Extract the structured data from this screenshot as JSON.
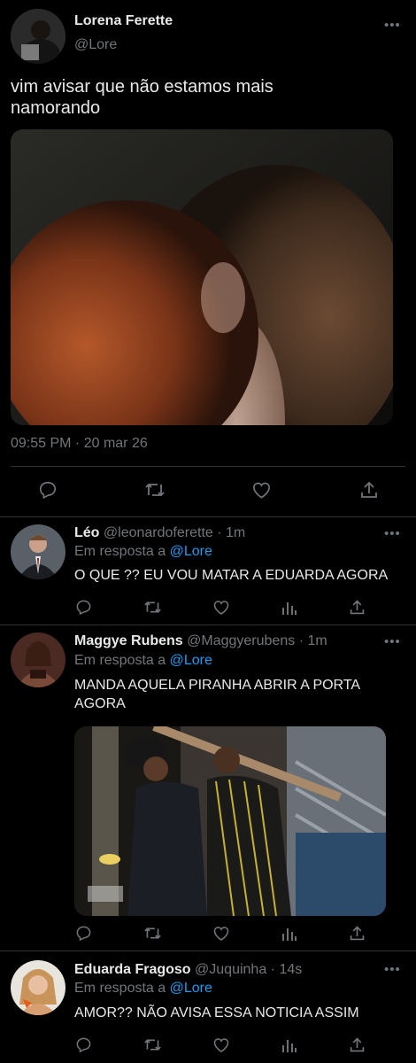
{
  "main_tweet": {
    "name": "Lorena Ferette",
    "handle": "@Lore",
    "more": "•••",
    "text_line1": "vim avisar que não estamos mais",
    "text_line2": "namorando",
    "timestamp": "09:55 PM · 20 mar 26"
  },
  "replies": [
    {
      "name": "Léo",
      "handle": "@leonardoferette",
      "time": "· 1m",
      "replying_prefix": "Em resposta a",
      "replying_to": "@Lore",
      "text_line1": "O QUE ?? EU VOU MATAR A EDUARDA AGORA",
      "more": "•••"
    },
    {
      "name": "Maggye Rubens",
      "handle": "@Maggyerubens",
      "time": "· 1m",
      "replying_prefix": "Em resposta a",
      "replying_to": "@Lore",
      "text_line1": "MANDA AQUELA PIRANHA ABRIR A PORTA",
      "text_line2": "AGORA",
      "more": "•••"
    },
    {
      "name": "Eduarda Fragoso",
      "handle": "@Juquinha",
      "time": "· 14s",
      "replying_prefix": "Em resposta a",
      "replying_to": "@Lore",
      "text_line1": "AMOR?? NÃO AVISA ESSA NOTICIA ASSIM",
      "more": "•••"
    }
  ],
  "icons": [
    "reply-icon",
    "retweet-icon",
    "like-icon",
    "analytics-icon",
    "share-icon"
  ],
  "colors": {
    "background": "#000000",
    "text": "#e7e9ea",
    "muted": "#71767b",
    "accent": "#1d9bf0",
    "divider": "#2f3336"
  }
}
